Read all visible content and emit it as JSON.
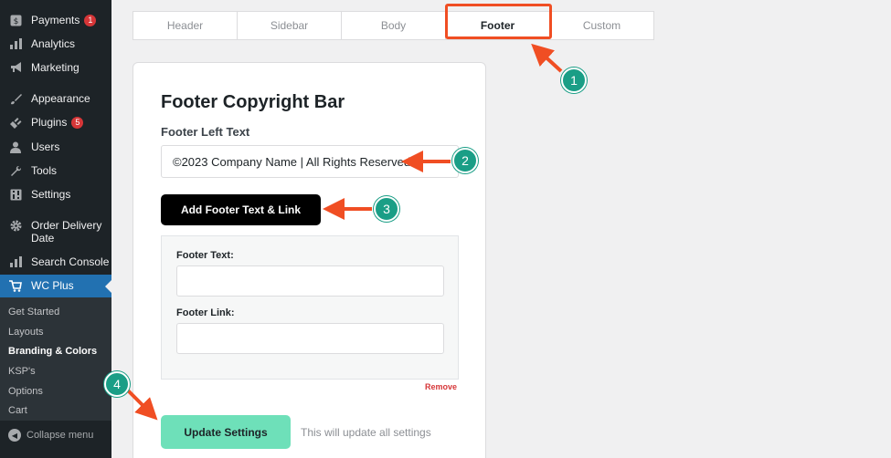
{
  "sidebar": {
    "items": [
      {
        "label": "Payments",
        "icon": "dollar-icon",
        "badge": "1"
      },
      {
        "label": "Analytics",
        "icon": "bar-chart-icon"
      },
      {
        "label": "Marketing",
        "icon": "megaphone-icon"
      },
      {
        "label": "Appearance",
        "icon": "paintbrush-icon"
      },
      {
        "label": "Plugins",
        "icon": "plugin-icon",
        "badge": "5"
      },
      {
        "label": "Users",
        "icon": "user-icon"
      },
      {
        "label": "Tools",
        "icon": "wrench-icon"
      },
      {
        "label": "Settings",
        "icon": "settings-icon"
      },
      {
        "label": "Order Delivery",
        "label2": "Date",
        "icon": "gear-icon"
      },
      {
        "label": "Search Console",
        "icon": "bar-chart-icon"
      },
      {
        "label": "WC Plus",
        "icon": "cart-icon"
      }
    ],
    "submenu": [
      {
        "label": "Get Started"
      },
      {
        "label": "Layouts"
      },
      {
        "label": "Branding & Colors"
      },
      {
        "label": "KSP's"
      },
      {
        "label": "Options"
      },
      {
        "label": "Cart"
      }
    ],
    "collapse_label": "Collapse menu"
  },
  "tabs": [
    "Header",
    "Sidebar",
    "Body",
    "Footer",
    "Custom"
  ],
  "active_tab": "Footer",
  "card": {
    "title": "Footer Copyright Bar",
    "left_text_label": "Footer Left Text",
    "left_text_value": "©2023 Company Name | All Rights Reserved",
    "add_button_label": "Add Footer Text & Link",
    "footer_text_label": "Footer Text:",
    "footer_text_value": "",
    "footer_link_label": "Footer Link:",
    "footer_link_value": "",
    "remove_label": "Remove",
    "update_button_label": "Update Settings",
    "update_note": "This will update all settings"
  },
  "annotations": {
    "step1": "1",
    "step2": "2",
    "step3": "3",
    "step4": "4"
  },
  "colors": {
    "sidebar_bg": "#1d2327",
    "active_menu": "#2271b1",
    "annotation_arrow": "#f04e23",
    "step_badge": "#1a9e86",
    "update_button": "#6ee0b9",
    "badge": "#d63638"
  }
}
